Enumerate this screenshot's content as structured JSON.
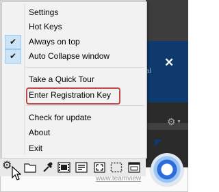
{
  "menu": {
    "items": [
      {
        "label": "Settings",
        "checked": false
      },
      {
        "label": "Hot Keys",
        "checked": false
      },
      {
        "label": "Always on top",
        "checked": true
      },
      {
        "label": "Auto Collapse window",
        "checked": true
      },
      {
        "label": "Take a Quick Tour",
        "checked": false
      },
      {
        "label": "Enter Registration Key",
        "checked": false,
        "highlighted": true
      },
      {
        "label": "Check for update",
        "checked": false
      },
      {
        "label": "About",
        "checked": false
      },
      {
        "label": "Exit",
        "checked": false
      }
    ]
  },
  "check_glyph": "✔",
  "background_app": {
    "close_glyph": "✕",
    "partial_text": "al",
    "url_text": "www.teamview"
  },
  "toolbar": {
    "icons": [
      "gear-icon",
      "folder-icon",
      "eyedropper-icon",
      "film-icon",
      "text-block-icon",
      "expand-icon",
      "selection-rect-icon",
      "window-icon"
    ]
  },
  "colors": {
    "highlight_border": "#c2464a",
    "check_bg": "#cce4f7",
    "app_blue": "#0e3a6d",
    "capture_button": "#2b6cd8"
  }
}
